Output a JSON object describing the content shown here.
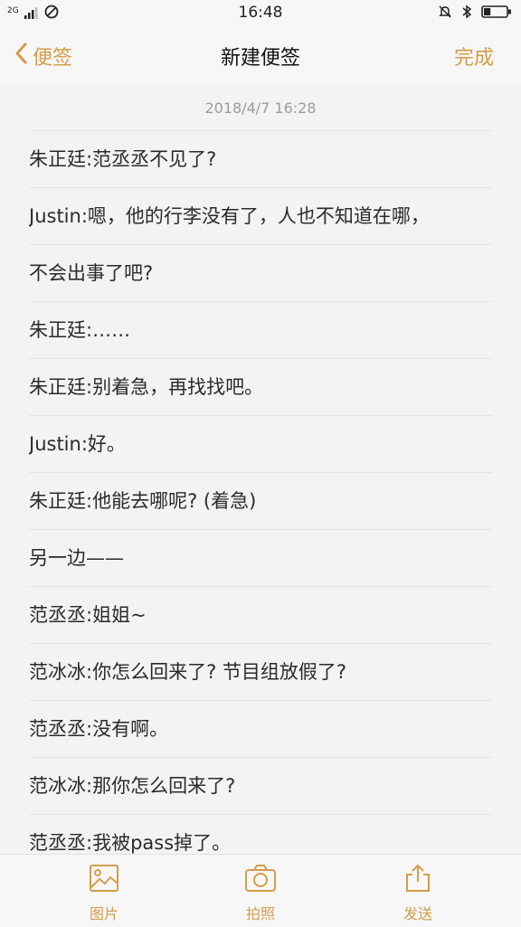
{
  "status_bar": {
    "network": "2G",
    "time": "16:48",
    "battery_level": 0.3
  },
  "nav": {
    "back_label": "便签",
    "title": "新建便签",
    "done_label": "完成"
  },
  "note": {
    "date": "2018/4/7  16:28",
    "lines": [
      "朱正廷:范丞丞不见了?",
      "Justin:嗯，他的行李没有了，人也不知道在哪，",
      "不会出事了吧?",
      "朱正廷:……",
      "朱正廷:别着急，再找找吧。",
      "Justin:好。",
      "朱正廷:他能去哪呢? (着急)",
      "另一边——",
      "范丞丞:姐姐~",
      "范冰冰:你怎么回来了? 节目组放假了?",
      "范丞丞:没有啊。",
      "范冰冰:那你怎么回来了?",
      "范丞丞:我被pass掉了。"
    ]
  },
  "toolbar": {
    "image_label": "图片",
    "photo_label": "拍照",
    "send_label": "发送"
  },
  "colors": {
    "accent": "#d39d4b",
    "text": "#2b2b2b",
    "background": "#f3f3f3"
  }
}
